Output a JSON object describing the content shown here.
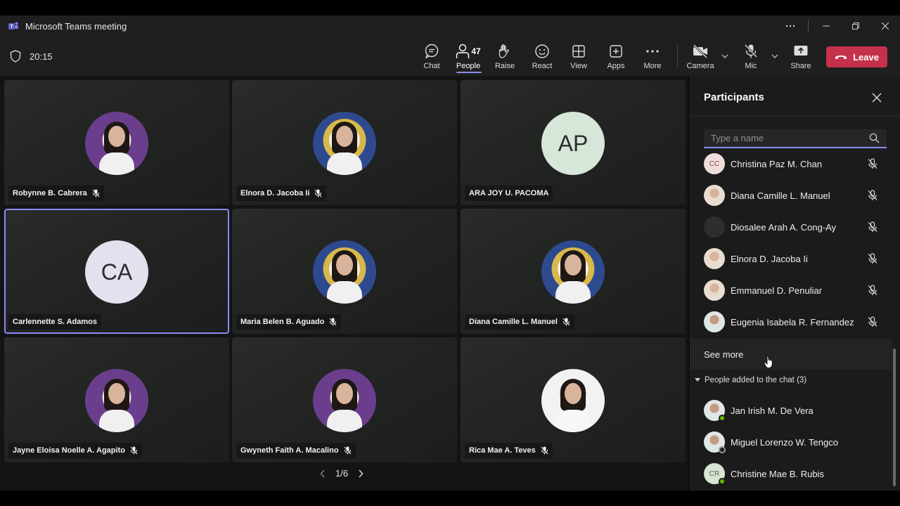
{
  "window": {
    "title": "Microsoft Teams meeting"
  },
  "meeting": {
    "timer": "20:15"
  },
  "toolbar": {
    "chat": "Chat",
    "people": "People",
    "people_count": "47",
    "raise": "Raise",
    "react": "React",
    "view": "View",
    "apps": "Apps",
    "more": "More",
    "camera": "Camera",
    "mic": "Mic",
    "share": "Share",
    "leave": "Leave"
  },
  "tiles": [
    {
      "name": "Robynne B. Cabrera",
      "initials": ""
    },
    {
      "name": "Elnora D. Jacoba Ii",
      "initials": ""
    },
    {
      "name": "ARA JOY U. PACOMA",
      "initials": "AP"
    },
    {
      "name": "Carlennette S. Adamos",
      "initials": "CA"
    },
    {
      "name": "Maria Belen B. Aguado",
      "initials": ""
    },
    {
      "name": "Diana Camille L. Manuel",
      "initials": ""
    },
    {
      "name": "Jayne Eloisa Noelle A. Agapito",
      "initials": ""
    },
    {
      "name": "Gwyneth Faith A. Macalino",
      "initials": ""
    },
    {
      "name": "Rica Mae A. Teves",
      "initials": ""
    }
  ],
  "pager": {
    "label": "1/6"
  },
  "participants_panel": {
    "title": "Participants",
    "search_placeholder": "Type a name",
    "in_meeting": [
      {
        "name": "Christina Paz M. Chan",
        "initials": "CC"
      },
      {
        "name": "Diana Camille L. Manuel",
        "initials": ""
      },
      {
        "name": "Diosalee Arah A. Cong-Ay",
        "initials": ""
      },
      {
        "name": "Elnora D. Jacoba Ii",
        "initials": ""
      },
      {
        "name": "Emmanuel D. Penuliar",
        "initials": ""
      },
      {
        "name": "Eugenia Isabela R. Fernandez",
        "initials": ""
      }
    ],
    "see_more": "See more",
    "group_header": "People added to the chat (3)",
    "added_to_chat": [
      {
        "name": "Jan Irish M. De Vera",
        "initials": "",
        "status": "available"
      },
      {
        "name": "Miguel Lorenzo W. Tengco",
        "initials": "",
        "status": "away"
      },
      {
        "name": "Christine Mae B. Rubis",
        "initials": "CR",
        "status": "available"
      }
    ]
  },
  "colors": {
    "accent": "#8b8cf2",
    "leave": "#c4314b",
    "available": "#6bb700"
  }
}
